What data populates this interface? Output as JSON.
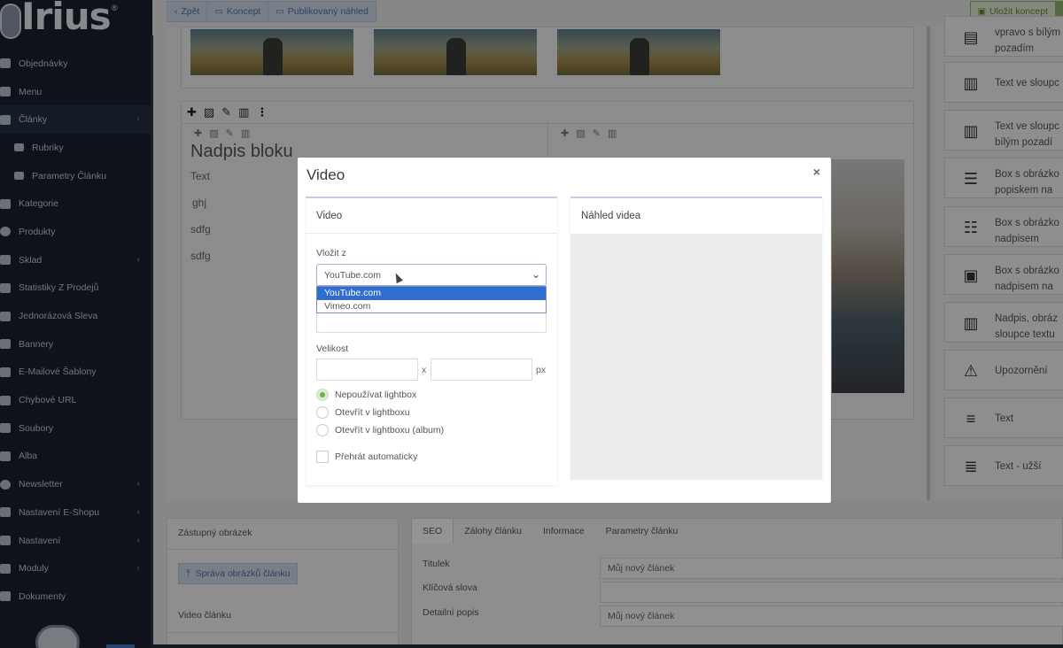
{
  "sidebar": {
    "logo_text": "Irius",
    "logo_mark": "®",
    "items": [
      {
        "label": "Objednávky",
        "icon": "cart-icon",
        "chevron": false
      },
      {
        "label": "Menu",
        "icon": "folder-icon",
        "chevron": false
      },
      {
        "label": "Články",
        "icon": "pencil-icon",
        "chevron": true,
        "active": true
      },
      {
        "label": "Rubriky",
        "icon": "card-icon",
        "chevron": false,
        "sub": true
      },
      {
        "label": "Parametry Článku",
        "icon": "sliders-icon",
        "chevron": false,
        "sub": true
      },
      {
        "label": "Kategorie",
        "icon": "list-icon",
        "chevron": false
      },
      {
        "label": "Produkty",
        "icon": "globe-icon",
        "chevron": false
      },
      {
        "label": "Sklad",
        "icon": "boxes-icon",
        "chevron": true
      },
      {
        "label": "Statistiky Z Prodejů",
        "icon": "chart-line-icon",
        "chevron": false
      },
      {
        "label": "Jednorázová Sleva",
        "icon": "tag-icon",
        "chevron": false
      },
      {
        "label": "Bannery",
        "icon": "image-icon",
        "chevron": false
      },
      {
        "label": "E-Mailové Šablony",
        "icon": "envelope-icon",
        "chevron": false
      },
      {
        "label": "Chybové URL",
        "icon": "link-icon",
        "chevron": false
      },
      {
        "label": "Soubory",
        "icon": "file-icon",
        "chevron": false
      },
      {
        "label": "Alba",
        "icon": "camera-icon",
        "chevron": false
      },
      {
        "label": "Newsletter",
        "icon": "newsletter-icon",
        "chevron": true
      },
      {
        "label": "Nastavení E-Shopu",
        "icon": "gears-icon",
        "chevron": true
      },
      {
        "label": "Nastavení",
        "icon": "gears-icon",
        "chevron": true
      },
      {
        "label": "Moduly",
        "icon": "puzzle-icon",
        "chevron": true
      },
      {
        "label": "Dokumenty",
        "icon": "list-icon",
        "chevron": false
      }
    ]
  },
  "topbar": {
    "back": "Zpět",
    "draft": "Koncept",
    "published": "Publikovaný náhled",
    "save": "Uložit koncept"
  },
  "editor": {
    "heading": "Nadpis bloku",
    "texts": [
      "Text",
      "ghj",
      "sdfg",
      "sdfg"
    ]
  },
  "widgets": [
    {
      "line1": "vpravo s bílým",
      "line2": "pozadím",
      "icon": "image-right-icon"
    },
    {
      "line1": "Text ve sloupc",
      "line2": "",
      "icon": "columns-icon"
    },
    {
      "line1": "Text ve sloupc",
      "line2": "bílým pozadí",
      "icon": "columns-boxed-icon"
    },
    {
      "line1": "Box s obrázko",
      "line2": "popiskem na",
      "icon": "image-caption-icon"
    },
    {
      "line1": "Box s obrázko",
      "line2": "nadpisem",
      "icon": "image-heading-icon"
    },
    {
      "line1": "Box s obrázko",
      "line2": "nadpisem na",
      "icon": "image-heading-box-icon"
    },
    {
      "line1": "Nadpis, obráz",
      "line2": "sloupce textu",
      "icon": "columns-boxed-icon"
    },
    {
      "line1": "Upozornění",
      "line2": "",
      "icon": "warning-icon"
    },
    {
      "line1": "Text",
      "line2": "",
      "icon": "text-align-icon"
    },
    {
      "line1": "Text - užší",
      "line2": "",
      "icon": "text-narrow-icon"
    }
  ],
  "bottom": {
    "placeholder_image": "Zástupný obrázek",
    "manage_images": "Správa obrázků článku",
    "article_video": "Video článku",
    "tabs": [
      "SEO",
      "Zálohy článku",
      "Informace",
      "Parametry článku"
    ],
    "fields": [
      {
        "label": "Titulek",
        "value": "Můj nový článek"
      },
      {
        "label": "Klíčová slova",
        "value": ""
      },
      {
        "label": "Detailní popis",
        "value": "Můj nový článek"
      }
    ]
  },
  "modal": {
    "title": "Video",
    "close": "×",
    "left_panel_title": "Video",
    "right_panel_title": "Náhled videa",
    "source_label": "Vložit z",
    "source_value": "YouTube.com",
    "source_options": [
      "YouTube.com",
      "Vimeo.com"
    ],
    "size_label": "Velikost",
    "size_sep": "x",
    "size_unit": "px",
    "lightbox_options": [
      "Nepoužívat lightbox",
      "Otevřít v lightboxu",
      "Otevřít v lightboxu (album)"
    ],
    "lightbox_selected": 0,
    "autoplay_label": "Přehrát automaticky"
  }
}
